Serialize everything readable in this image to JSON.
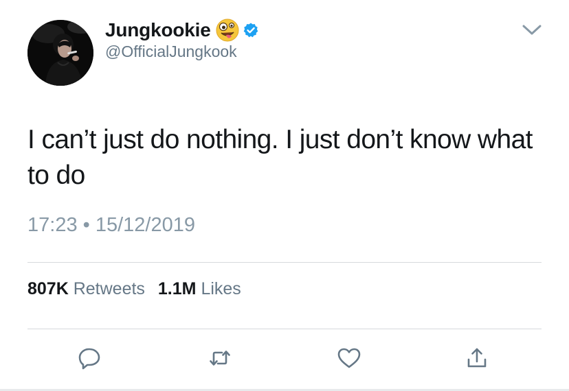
{
  "user": {
    "display_name": "Jungkookie",
    "emoji_icon": "zany-face-emoji",
    "verified_icon": "verified-badge-icon",
    "handle": "@OfficialJungkook"
  },
  "tweet": {
    "text": "I can’t just do nothing. I just don’t know what to do",
    "time": "17:23",
    "separator": "•",
    "date": "15/12/2019"
  },
  "stats": {
    "retweets_count": "807K",
    "retweets_label": "Retweets",
    "likes_count": "1.1M",
    "likes_label": "Likes"
  },
  "actions": {
    "icons": [
      "reply-icon",
      "retweet-icon",
      "like-icon",
      "share-icon"
    ]
  },
  "colors": {
    "text": "#14171a",
    "secondary": "#657786",
    "timestamp": "#8899a6",
    "verified": "#1da1f2",
    "divider": "#d6d9dc"
  }
}
